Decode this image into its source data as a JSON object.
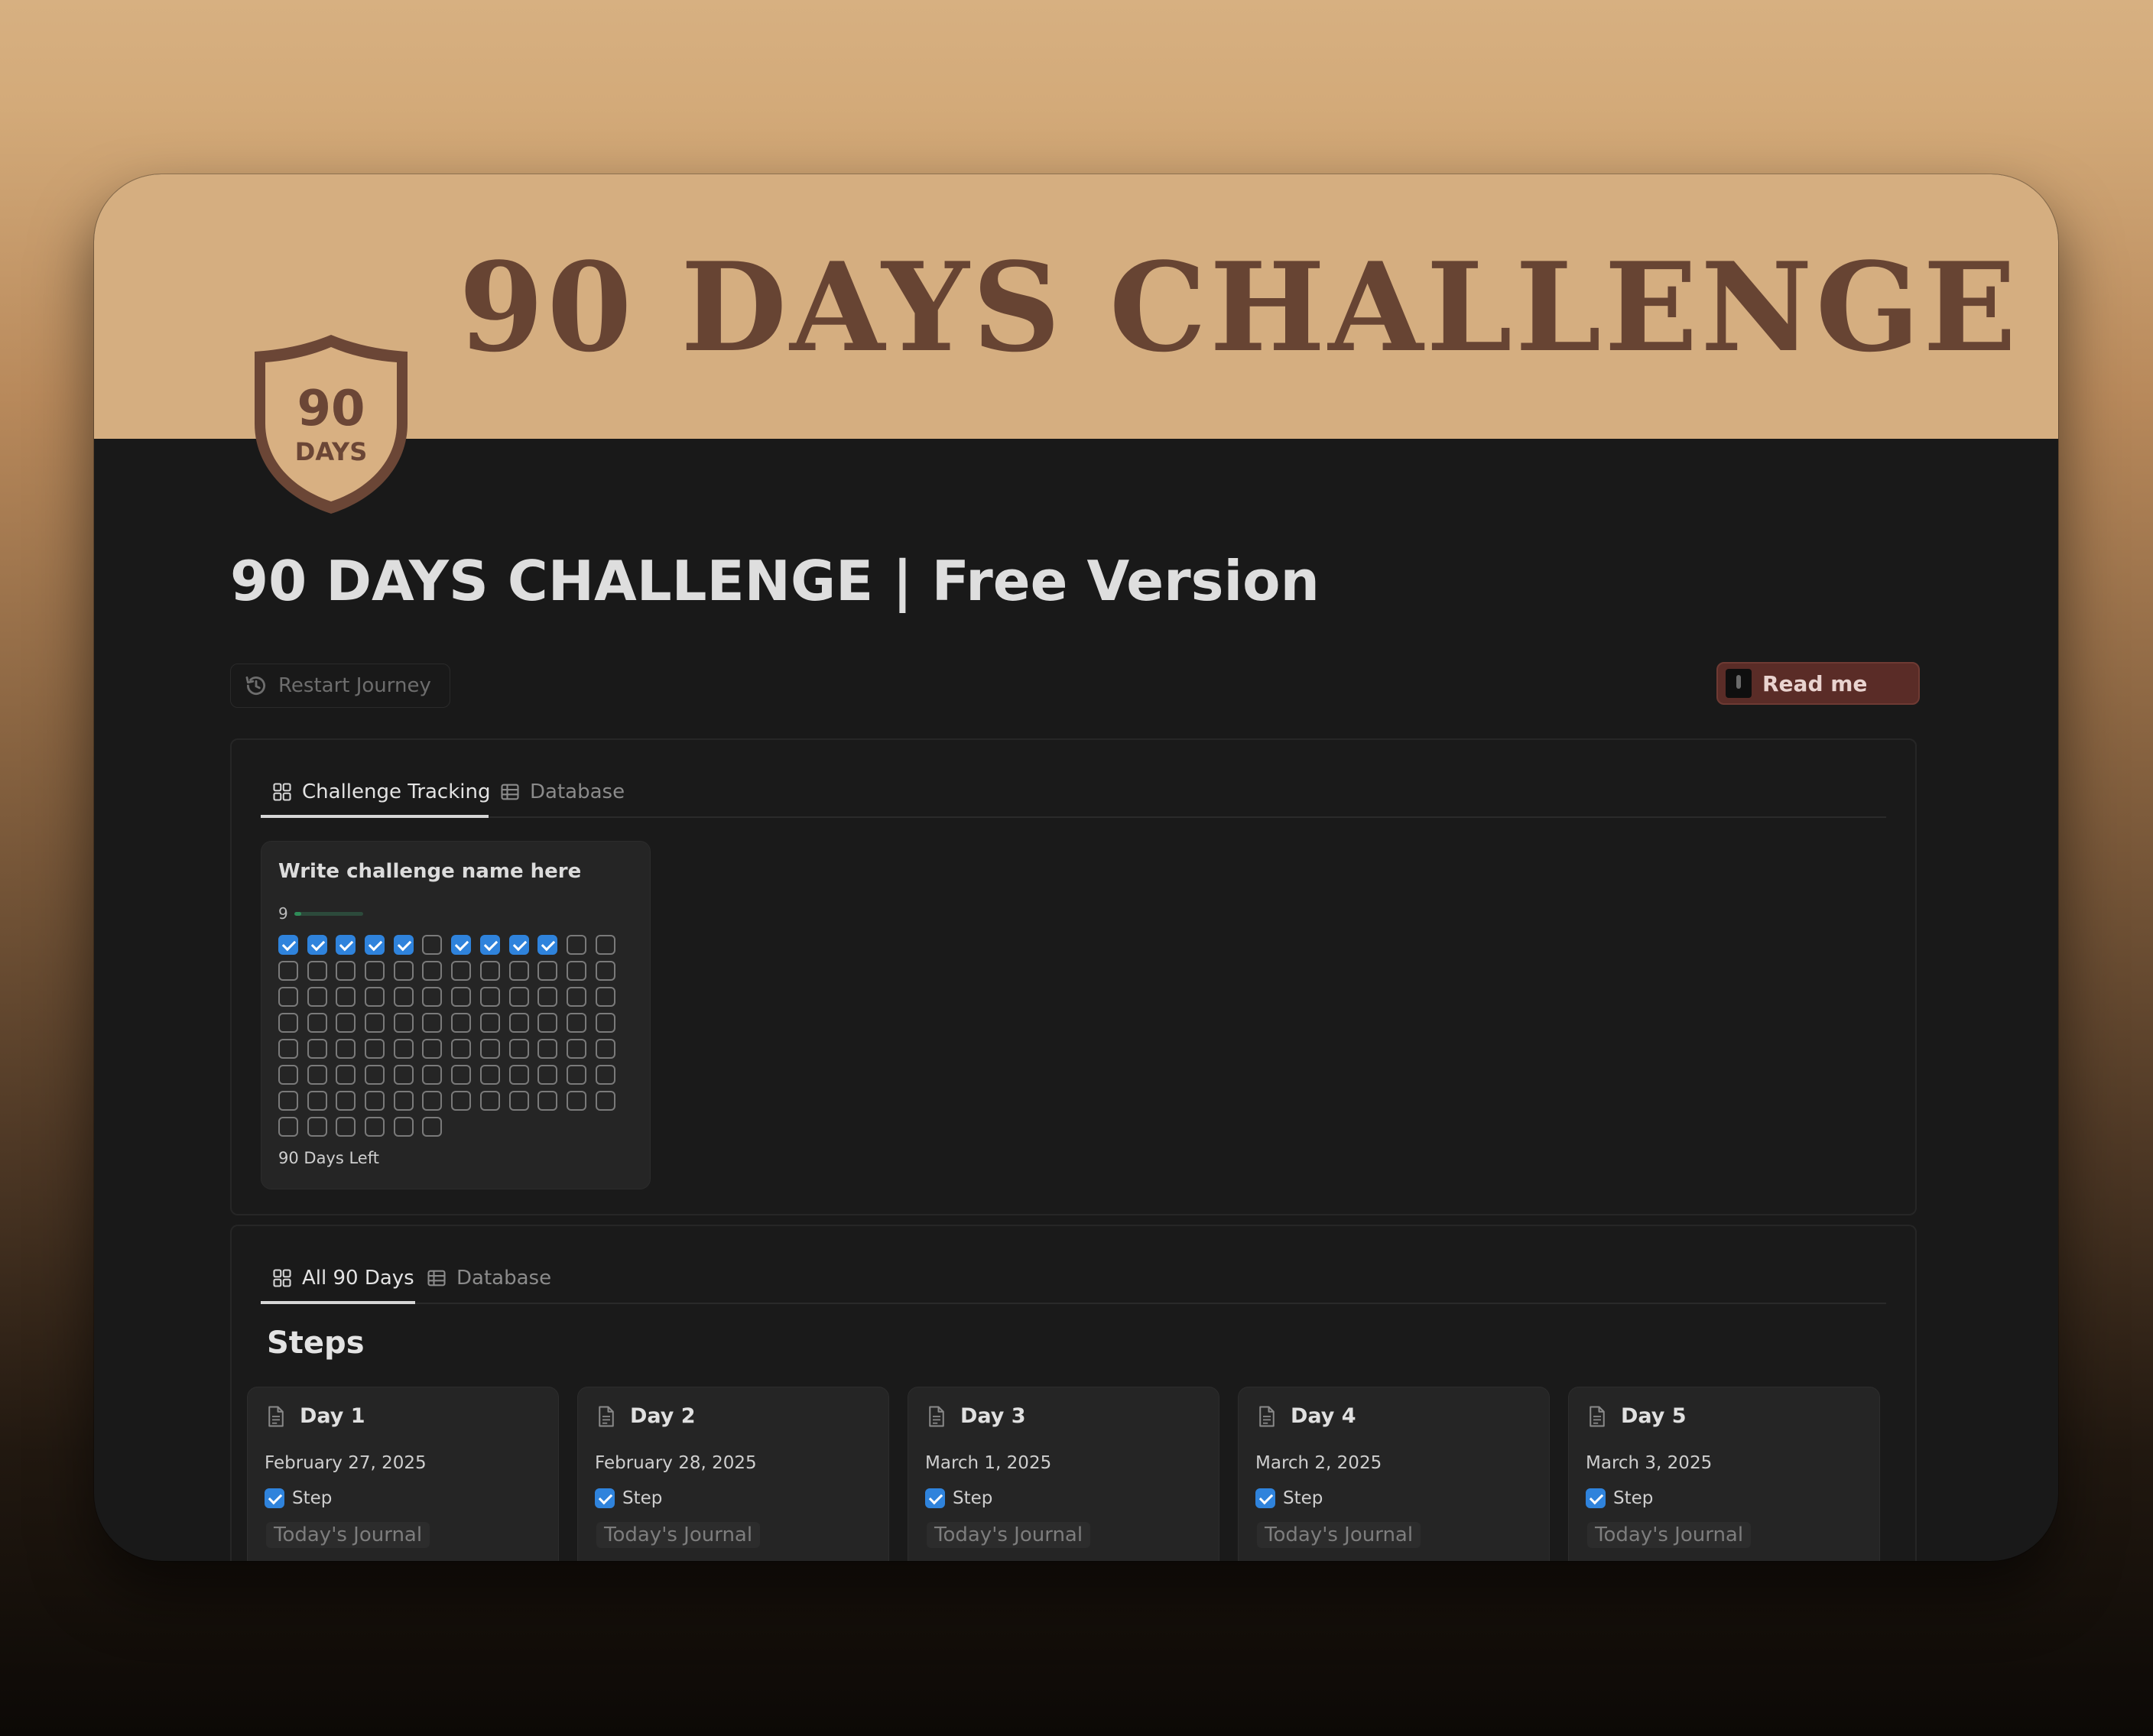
{
  "cover": {
    "title": "90 DAYS CHALLENGE"
  },
  "badge": {
    "number": "90",
    "label": "DAYS"
  },
  "page": {
    "title": "90 DAYS CHALLENGE | Free Version"
  },
  "actions": {
    "restart_label": "Restart Journey",
    "readme_label": "Read me"
  },
  "tracking_section": {
    "tabs": [
      {
        "label": "Challenge Tracking",
        "icon": "gallery-icon",
        "active": true
      },
      {
        "label": "Database",
        "icon": "table-icon",
        "active": false
      }
    ],
    "card": {
      "name": "Write challenge name here",
      "progress_value": "9",
      "progress_fraction": 0.1,
      "checked_days": [
        1,
        2,
        3,
        4,
        5,
        7,
        8,
        9,
        10
      ],
      "total_days": 90,
      "days_left_label": "90 Days Left"
    }
  },
  "days_section": {
    "tabs": [
      {
        "label": "All 90 Days",
        "icon": "gallery-icon",
        "active": true
      },
      {
        "label": "Database",
        "icon": "table-icon",
        "active": false
      }
    ],
    "group_title": "Steps",
    "cards": [
      {
        "title": "Day 1",
        "date": "February 27, 2025",
        "step_label": "Step",
        "step_checked": true,
        "journal_label": "Today's Journal"
      },
      {
        "title": "Day 2",
        "date": "February 28, 2025",
        "step_label": "Step",
        "step_checked": true,
        "journal_label": "Today's Journal"
      },
      {
        "title": "Day 3",
        "date": "March 1, 2025",
        "step_label": "Step",
        "step_checked": true,
        "journal_label": "Today's Journal"
      },
      {
        "title": "Day 4",
        "date": "March 2, 2025",
        "step_label": "Step",
        "step_checked": true,
        "journal_label": "Today's Journal"
      },
      {
        "title": "Day 5",
        "date": "March 3, 2025",
        "step_label": "Step",
        "step_checked": true,
        "journal_label": "Today's Journal"
      }
    ]
  },
  "colors": {
    "cover_bg": "#d5ae80",
    "cover_text": "#674433",
    "page_bg": "#191919",
    "checkbox_checked": "#2f83dc",
    "progress_fill": "#2f8c58",
    "readme_bg": "#5a2c27"
  }
}
